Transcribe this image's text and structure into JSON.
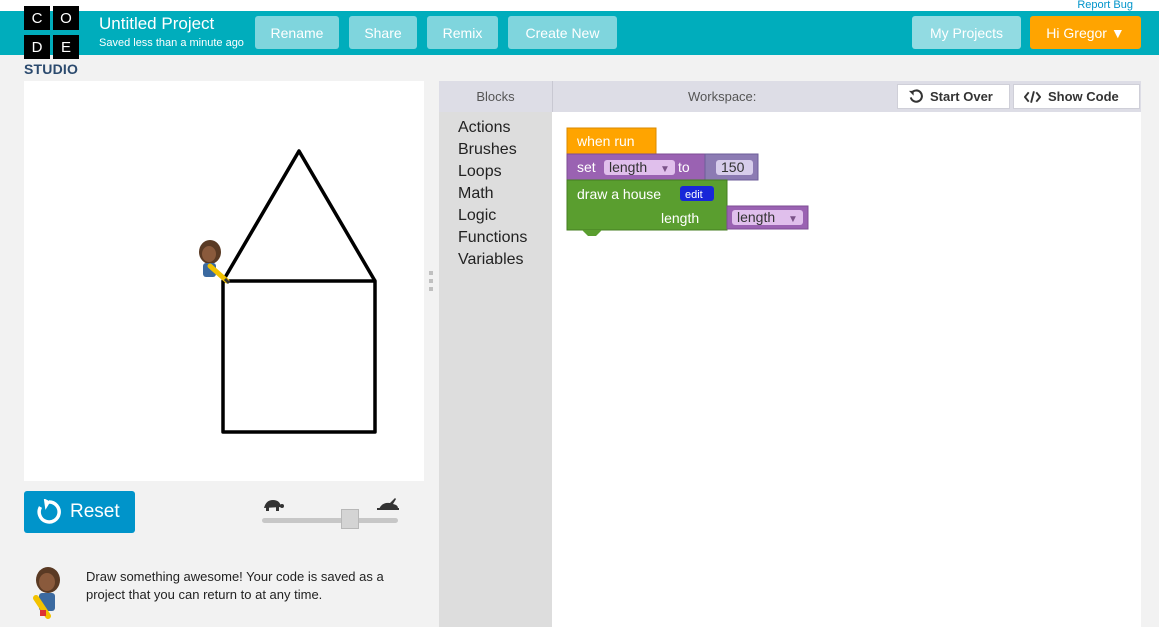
{
  "header": {
    "report_bug": "Report Bug",
    "logo_letters": [
      "C",
      "O",
      "D",
      "E"
    ],
    "logo_studio": "STUDIO",
    "project_title": "Untitled Project",
    "saved_status": "Saved less than a minute ago",
    "buttons": {
      "rename": "Rename",
      "share": "Share",
      "remix": "Remix",
      "create_new": "Create New",
      "my_projects": "My Projects",
      "user_menu": "Hi Gregor ▼"
    },
    "colors": {
      "bar": "#00adbc",
      "user_menu": "#ffa400"
    }
  },
  "stage": {
    "reset_label": "Reset",
    "speed_slider": {
      "value": 0.65,
      "slow_icon": "turtle-icon",
      "fast_icon": "rabbit-icon"
    },
    "instructions": "Draw something awesome! Your code is saved as a project that you can return to at any time."
  },
  "toolbox": {
    "header": "Blocks",
    "categories": [
      "Actions",
      "Brushes",
      "Loops",
      "Math",
      "Logic",
      "Functions",
      "Variables"
    ]
  },
  "workspace": {
    "header": "Workspace:",
    "start_over": "Start Over",
    "show_code": "Show Code",
    "blocks": {
      "when_run": "when run",
      "set_label": "set",
      "set_var": "length",
      "set_to": "to",
      "set_value": "150",
      "function_name": "draw a house",
      "edit_label": "edit",
      "param_label": "length",
      "param_value": "length"
    }
  }
}
